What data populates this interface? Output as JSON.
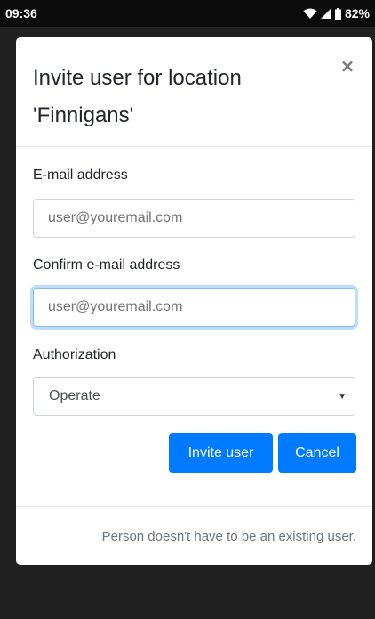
{
  "status_bar": {
    "time": "09:36",
    "battery": "82%",
    "icons": [
      "wifi-icon",
      "signal-icon",
      "battery-icon"
    ]
  },
  "modal": {
    "title": "Invite user for location 'Finnigans'",
    "close_label": "×",
    "email": {
      "label": "E-mail address",
      "placeholder": "user@youremail.com",
      "value": ""
    },
    "confirm_email": {
      "label": "Confirm e-mail address",
      "placeholder": "user@youremail.com",
      "value": ""
    },
    "authorization": {
      "label": "Authorization",
      "selected": "Operate"
    },
    "buttons": {
      "invite": "Invite user",
      "cancel": "Cancel"
    },
    "footer_note": "Person doesn't have to be an existing user."
  },
  "colors": {
    "primary": "#007bff",
    "focus_border": "#80bdff",
    "muted_text": "#6c757d",
    "backdrop": "#202020"
  }
}
